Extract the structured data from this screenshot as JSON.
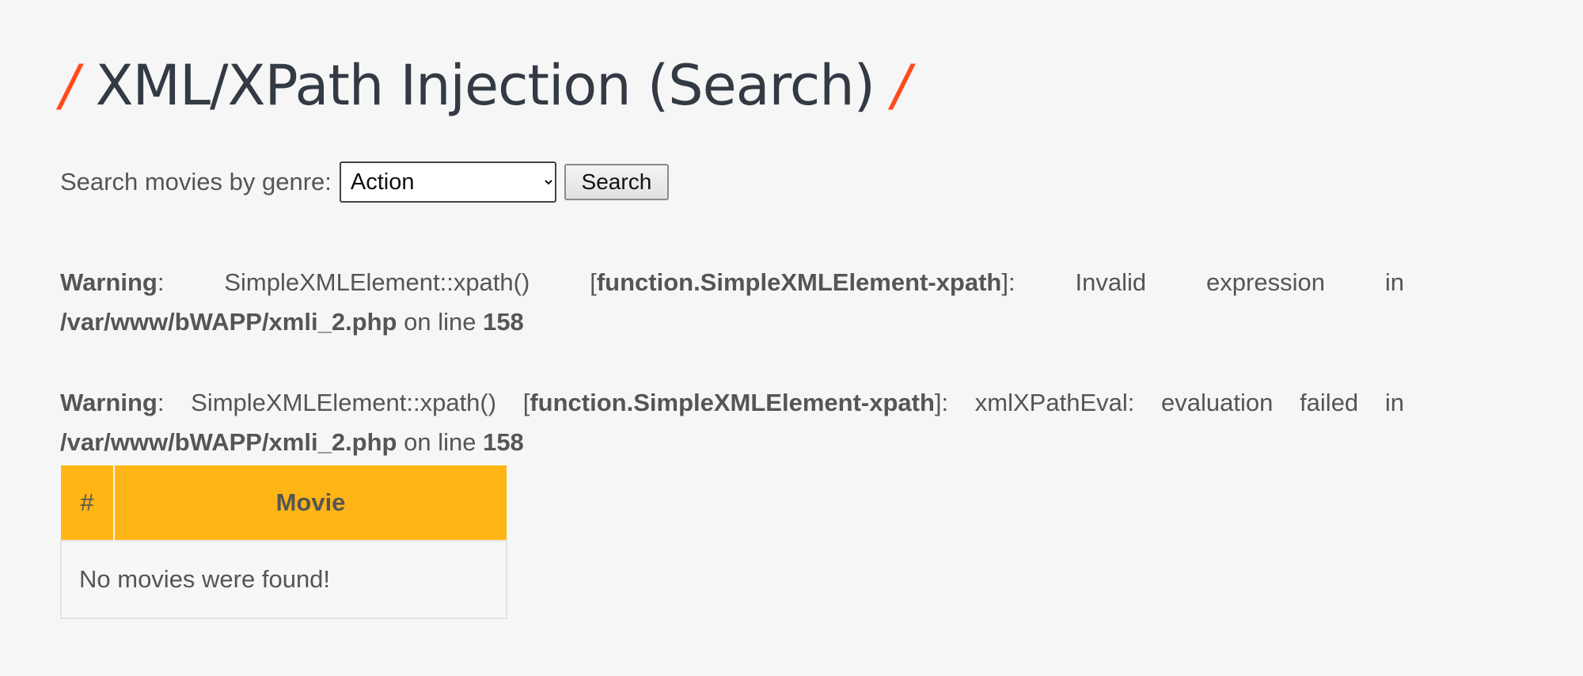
{
  "page": {
    "title_slash": "/",
    "title": "XML/XPath Injection (Search)"
  },
  "search": {
    "label": "Search movies by genre:",
    "selected_genre": "Action",
    "button_label": "Search"
  },
  "warnings": [
    {
      "prefix": "Warning",
      "sep1": ": SimpleXMLElement::xpath() [",
      "function": "function.SimpleXMLElement-xpath",
      "message": "]: Invalid expression in ",
      "file": "/var/www/bWAPP/xmli_2.php",
      "on_line": " on line ",
      "line": "158"
    },
    {
      "prefix": "Warning",
      "sep1": ": SimpleXMLElement::xpath() [",
      "function": "function.SimpleXMLElement-xpath",
      "message": "]: xmlXPathEval: evaluation failed in ",
      "file": "/var/www/bWAPP/xmli_2.php",
      "on_line": " on line ",
      "line": "158"
    }
  ],
  "table": {
    "headers": [
      "#",
      "Movie"
    ],
    "empty_message": "No movies were found!"
  },
  "colors": {
    "accent_slash": "#ff4a1a",
    "table_header": "#ffb515",
    "background": "#f6f6f6",
    "title_text": "#333a44"
  }
}
